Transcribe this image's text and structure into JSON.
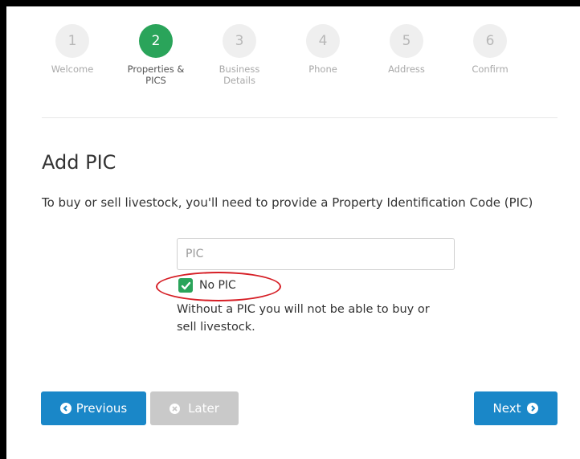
{
  "stepper": {
    "steps": [
      {
        "number": "1",
        "label": "Welcome"
      },
      {
        "number": "2",
        "label": "Properties &\nPICS"
      },
      {
        "number": "3",
        "label": "Business\nDetails"
      },
      {
        "number": "4",
        "label": "Phone"
      },
      {
        "number": "5",
        "label": "Address"
      },
      {
        "number": "6",
        "label": "Confirm"
      }
    ],
    "active_step": 2,
    "active_color": "#2aa45a"
  },
  "form": {
    "title": "Add PIC",
    "description": "To buy or sell livestock, you'll need to provide a Property Identification Code (PIC)",
    "pic_input": {
      "placeholder": "PIC",
      "value": ""
    },
    "no_pic": {
      "label": "No PIC",
      "checked": true
    },
    "warning": "Without a PIC you will not be able to buy or sell livestock."
  },
  "buttons": {
    "previous": {
      "label": "Previous",
      "icon": "chevron-left-circle-icon"
    },
    "later": {
      "label": "Later",
      "icon": "x-circle-icon"
    },
    "next": {
      "label": "Next",
      "icon": "chevron-right-circle-icon"
    }
  },
  "colors": {
    "primary": "#1a87c8",
    "success": "#2aa45a",
    "highlight": "#d61f26",
    "disabled": "#c9c9c9"
  }
}
